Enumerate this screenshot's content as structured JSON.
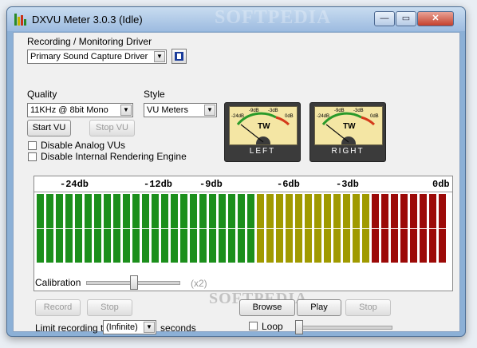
{
  "window": {
    "title": "DXVU Meter 3.0.3 (Idle)",
    "controls": {
      "minimize": "—",
      "maximize": "▭",
      "close": "✕"
    }
  },
  "driver": {
    "section_label": "Recording / Monitoring Driver",
    "selected": "Primary Sound Capture Driver",
    "properties_icon": "properties-icon"
  },
  "quality": {
    "label": "Quality",
    "selected": "11KHz @ 8bit Mono"
  },
  "style": {
    "label": "Style",
    "selected": "VU Meters"
  },
  "buttons": {
    "start_vu": "Start VU",
    "stop_vu": "Stop VU",
    "record": "Record",
    "stop_record": "Stop",
    "browse": "Browse",
    "play": "Play",
    "stop_play": "Stop"
  },
  "checkboxes": {
    "disable_analog": "Disable Analog VUs",
    "disable_rendering": "Disable Internal Rendering Engine"
  },
  "vu_meters": [
    {
      "channel": "LEFT",
      "brand": "TW",
      "marks": [
        "-24dB",
        "-9dB",
        "-3dB",
        "0dB"
      ]
    },
    {
      "channel": "RIGHT",
      "brand": "TW",
      "marks": [
        "-24dB",
        "-9dB",
        "-3dB",
        "0dB"
      ]
    }
  ],
  "level_meter": {
    "scale_labels": [
      "-24db",
      "-12db",
      "-9db",
      "-6db",
      "-3db",
      "0db"
    ],
    "colors": {
      "green": "#1c8f1c",
      "olive": "#a09a00",
      "red": "#9c0a08"
    }
  },
  "calibration": {
    "label": "Calibration",
    "multiplier": "(x2)",
    "level": 0.52
  },
  "limit": {
    "label": "Limit recording to",
    "selected": "(Infinite)",
    "unit": "seconds"
  },
  "loop": {
    "label": "Loop",
    "position": 0
  },
  "watermark": "SOFTPEDIA"
}
